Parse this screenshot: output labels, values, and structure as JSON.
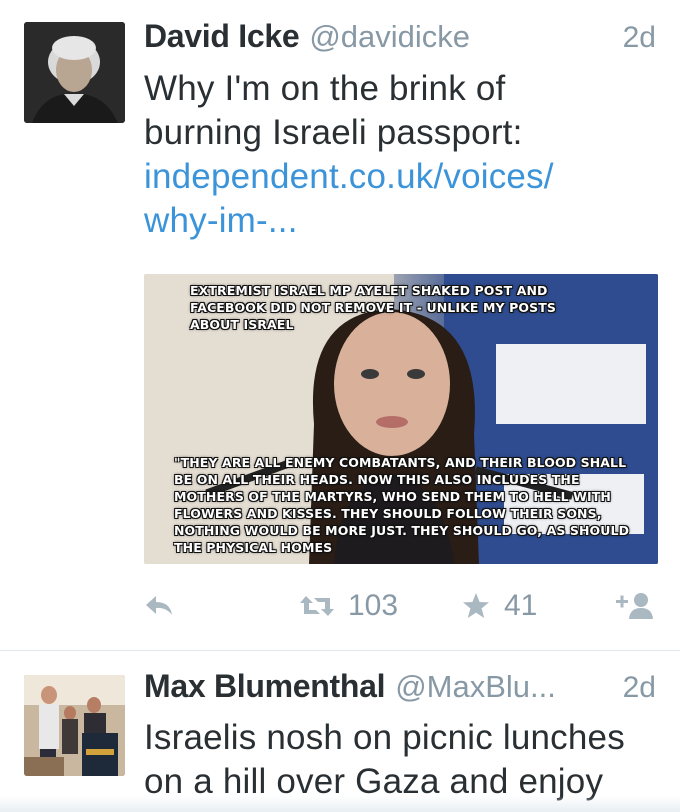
{
  "tweets": [
    {
      "display_name": "David Icke",
      "handle": "@davidicke",
      "timestamp": "2d",
      "text_lines": [
        "Why I'm on the brink of",
        "burning Israeli passport:"
      ],
      "link_lines": [
        "independent.co.uk/voices/",
        "why-im-..."
      ],
      "media": {
        "caption_top": "Extremist Israel MP Ayelet Shaked post and Facebook did not remove it - unlike my posts about Israel",
        "caption_bottom": "\"They are all enemy combatants, and their blood shall be on all their heads. Now this also includes the mothers of the martyrs, who send them to hell with flowers and kisses. They should follow their sons, nothing would be more just. They should go, as should the physical homes"
      },
      "actions": {
        "reply_icon": "reply-icon",
        "retweet_icon": "retweet-icon",
        "retweet_count": "103",
        "favorite_icon": "star-icon",
        "favorite_count": "41",
        "follow_icon": "follow-user-icon"
      }
    },
    {
      "display_name": "Max Blumenthal",
      "handle": "@MaxBlu...",
      "timestamp": "2d",
      "text_lines": [
        "Israelis nosh on picnic lunches",
        "on a hill over Gaza and enjoy"
      ]
    }
  ],
  "colors": {
    "name": "#292f33",
    "meta": "#8899a6",
    "link": "#3b94d9",
    "icon": "#aab8c2",
    "divider": "#e1e8ed"
  }
}
